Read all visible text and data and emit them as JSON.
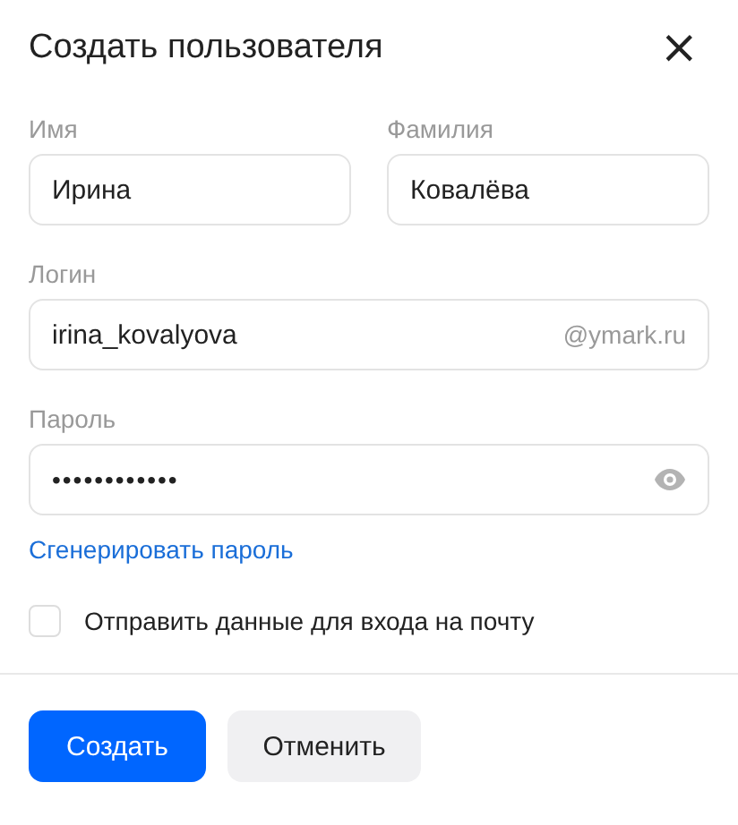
{
  "dialog": {
    "title": "Создать пользователя",
    "close": "×"
  },
  "fields": [
    {
      "kind": "text",
      "label": "Имя",
      "value": "Ирина"
    },
    {
      "kind": "text",
      "label": "Фамилия",
      "value": "Ковалёва"
    },
    {
      "kind": "login",
      "label": "Логин",
      "value": "irina_kovalyova",
      "suffix": "@ymark.ru"
    },
    {
      "kind": "password",
      "label": "Пароль",
      "value": "••••••••••••"
    }
  ],
  "generate_link": "Сгенерировать пароль",
  "send_checkbox": {
    "label": "Отправить данные для входа на почту",
    "checked": false
  },
  "buttons": [
    {
      "label": "Создать",
      "kind": "primary"
    },
    {
      "label": "Отменить",
      "kind": "secondary"
    }
  ]
}
